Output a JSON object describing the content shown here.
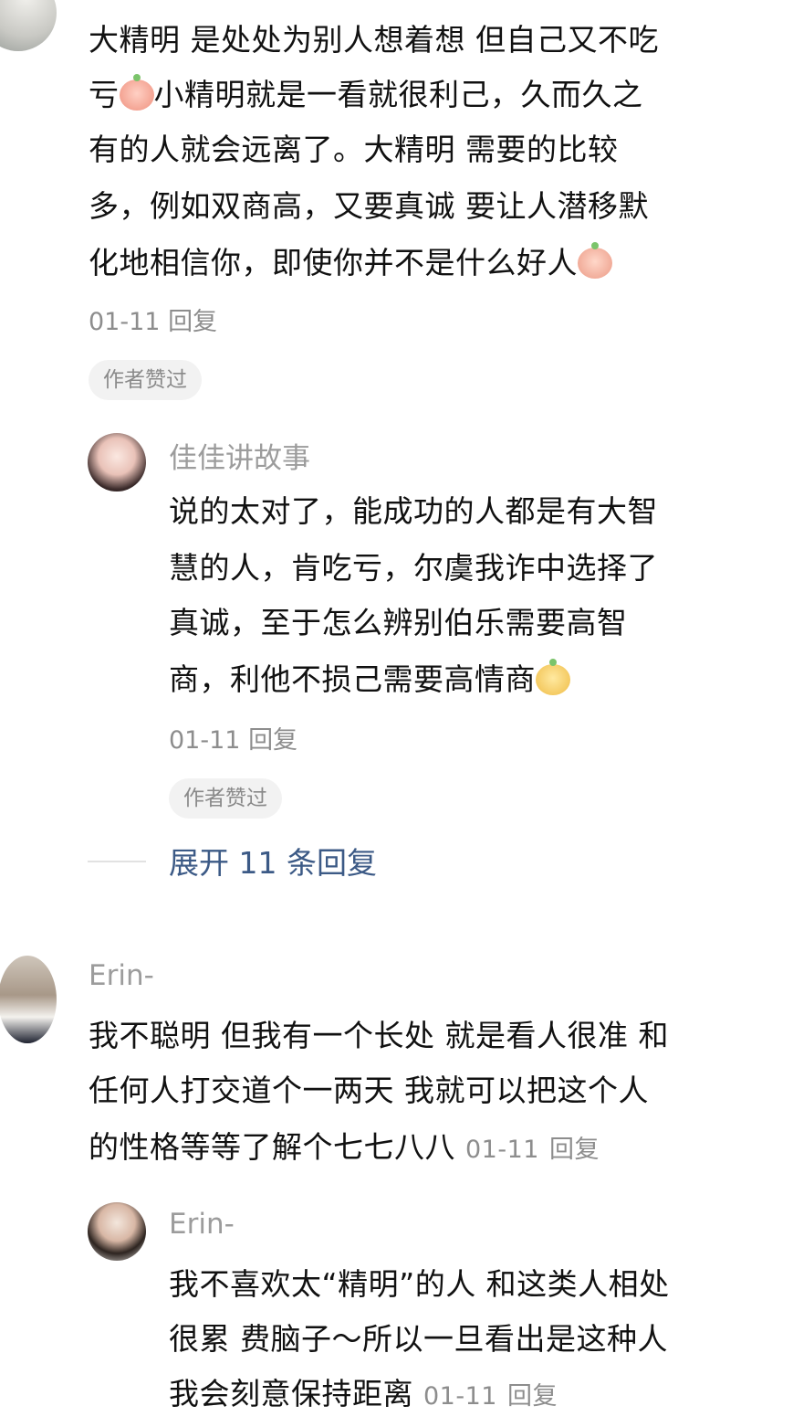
{
  "comments": [
    {
      "lines": [
        "大精明 是处处为别人想着想 但自己又不吃",
        "亏",
        "小精明就是一看就很利己，久而久之",
        "有的人就会远离了。大精明 需要的比较",
        "多，例如双商高，又要真诚 要让人潜移默",
        "化地相信你，即使你并不是什么好人"
      ],
      "date": "01-11",
      "reply_label": "回复",
      "badge": "作者赞过"
    },
    {
      "name": "佳佳讲故事",
      "lines": [
        "说的太对了，能成功的人都是有大智",
        "慧的人，肯吃亏，尔虞我诈中选择了",
        "真诚，至于怎么辨别伯乐需要高智",
        "商，利他不损己需要高情商"
      ],
      "date": "01-11",
      "reply_label": "回复",
      "badge": "作者赞过"
    },
    {
      "name": "Erin-",
      "lines": [
        "我不聪明 但我有一个长处 就是看人很准 和",
        "任何人打交道个一两天 我就可以把这个人",
        "的性格等等了解个七七八八"
      ],
      "date": "01-11",
      "reply_label": "回复"
    },
    {
      "name": "Erin-",
      "lines": [
        "我不喜欢太“精明”的人 和这类人相处",
        "很累 费脑子～所以一旦看出是这种人",
        "我会刻意保持距离"
      ],
      "date": "01-11",
      "reply_label": "回复"
    }
  ],
  "expand_replies": "展开 11 条回复",
  "icons": [
    "cry-emoji-icon",
    "smirk-emoji-icon",
    "happy-emoji-icon"
  ]
}
